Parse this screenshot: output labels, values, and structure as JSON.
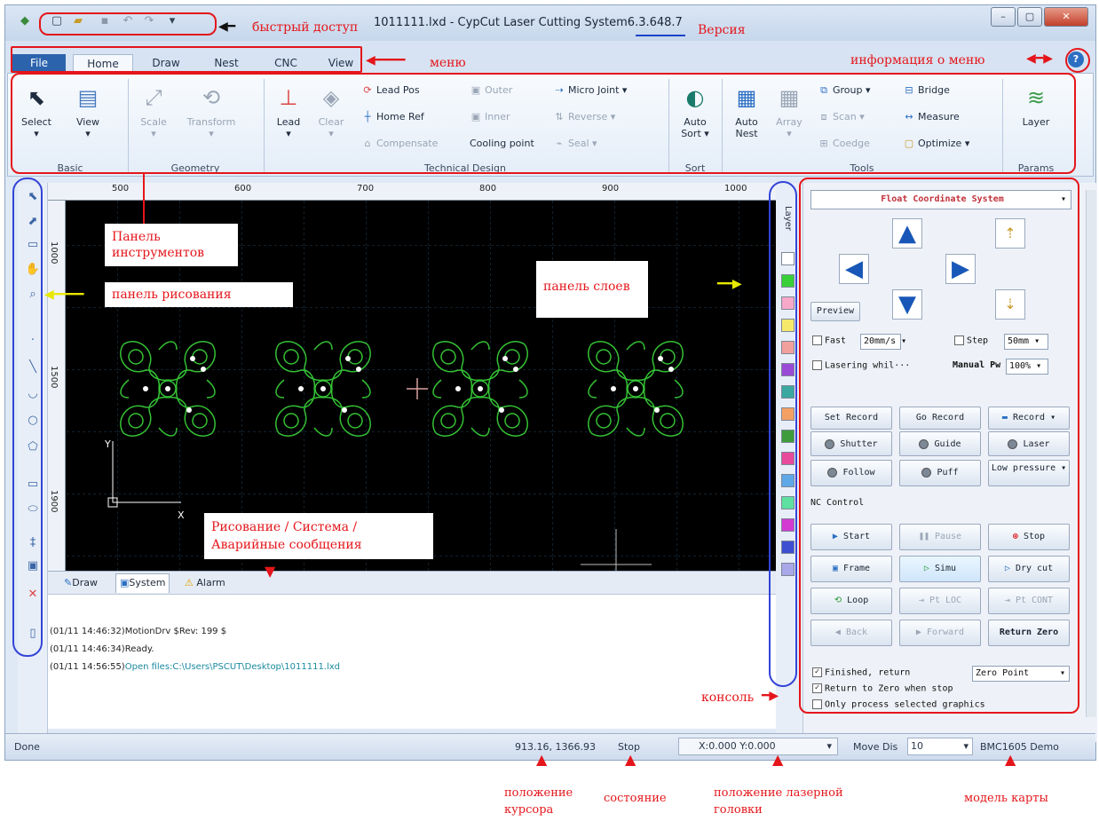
{
  "window": {
    "title": "1011111.lxd - CypCut Laser Cutting System",
    "version": "6.3.648.7",
    "quick_access_icons": [
      "app-logo-icon",
      "new-file-icon",
      "open-file-icon",
      "save-icon",
      "undo-icon",
      "redo-icon",
      "customize-icon"
    ],
    "controls": [
      "minimize",
      "maximize",
      "close"
    ]
  },
  "menu": {
    "file": "File",
    "tabs": [
      "Home",
      "Draw",
      "Nest",
      "CNC",
      "View"
    ],
    "help_icon": "help-icon"
  },
  "ribbon": {
    "basic": {
      "label": "Basic",
      "select": "Select",
      "view": "View"
    },
    "geometry": {
      "label": "Geometry",
      "scale": "Scale",
      "transform": "Transform"
    },
    "technical": {
      "label": "Technical Design",
      "lead": "Lead",
      "clear": "Clear",
      "lead_pos": "Lead Pos",
      "home_ref": "Home Ref",
      "compensate": "Compensate",
      "outer": "Outer",
      "inner": "Inner",
      "cooling_point": "Cooling point",
      "micro_joint": "Micro Joint",
      "reverse": "Reverse",
      "seal": "Seal"
    },
    "sort": {
      "label": "Sort",
      "auto_sort": "Auto Sort"
    },
    "tools": {
      "label": "Tools",
      "auto_nest": "Auto Nest",
      "array": "Array",
      "group": "Group",
      "scan": "Scan",
      "coedge": "Coedge",
      "bridge": "Bridge",
      "measure": "Measure",
      "optimize": "Optimize"
    },
    "params": {
      "label": "Params",
      "layer": "Layer"
    }
  },
  "canvas": {
    "ruler_top": [
      "500",
      "600",
      "700",
      "800",
      "900",
      "1000"
    ],
    "ruler_left": [
      "1000",
      "1500",
      "1900"
    ],
    "axis_x": "X",
    "axis_y": "Y"
  },
  "layer_panel": {
    "title": "Layer",
    "colors": [
      "#ffffff",
      "#38d038",
      "#f7a8c8",
      "#f5e96a",
      "#f2a09c",
      "#9a4bd6",
      "#3aa8a0",
      "#f4a064",
      "#3e9c3c",
      "#e84a9c",
      "#5ea8e8",
      "#5fe0a0",
      "#d23ad2",
      "#3d4ed2",
      "#a8a8e8"
    ]
  },
  "console": {
    "coordinate_system": "Float Coordinate System",
    "preview": "Preview",
    "fast_label": "Fast",
    "fast_value": "20mm/s",
    "step_label": "Step",
    "step_value": "50mm",
    "lasering_while": "Lasering whil···",
    "manual_pw_label": "Manual Pw",
    "manual_pw_value": "100%",
    "set_record": "Set Record",
    "go_record": "Go Record",
    "record": "Record",
    "shutter": "Shutter",
    "guide": "Guide",
    "laser": "Laser",
    "follow": "Follow",
    "puff": "Puff",
    "low_pressure": "Low pressure",
    "nc_control": "NC Control",
    "start": "Start",
    "pause": "Pause",
    "stop": "Stop",
    "frame": "Frame",
    "simu": "Simu",
    "dry_cut": "Dry cut",
    "loop": "Loop",
    "pt_loc": "Pt LOC",
    "pt_cont": "Pt CONT",
    "back": "Back",
    "forward": "Forward",
    "return_zero": "Return Zero",
    "finished_return": "Finished, return",
    "zero_point": "Zero Point",
    "return_to_zero_when_stop": "Return to Zero when stop",
    "only_process_selected": "Only process selected graphics"
  },
  "bottom_tabs": {
    "draw": "Draw",
    "system": "System",
    "alarm": "Alarm"
  },
  "log": {
    "lines": [
      {
        "time": "(01/11 14:46:32)",
        "text": "MotionDrv $Rev: 199 $"
      },
      {
        "time": "(01/11 14:46:34)",
        "text": "Ready."
      },
      {
        "time": "(01/11 14:56:55)",
        "text": "Open files:C:\\Users\\PSCUT\\Desktop\\1011111.lxd"
      }
    ]
  },
  "status_bar": {
    "done": "Done",
    "cursor_position": "913.16, 1366.93",
    "state": "Stop",
    "head_position": "X:0.000 Y:0.000",
    "move_dis_label": "Move Dis",
    "move_dis_value": "10",
    "card_model": "BMC1605 Demo"
  },
  "annotations": {
    "quick_access": "быстрый доступ",
    "version": "Версия",
    "menu": "меню",
    "menu_info": "информация о меню",
    "toolbar_panel": "Панель инструментов",
    "drawing_panel": "панель рисования",
    "layers_panel": "панель слоев",
    "messages": "Рисование / Система / Аварийные сообщения",
    "console": "консоль",
    "cursor_pos": "положение курсора",
    "state": "состояние",
    "laser_head_pos": "положение лазерной головки",
    "card_model": "модель карты"
  }
}
